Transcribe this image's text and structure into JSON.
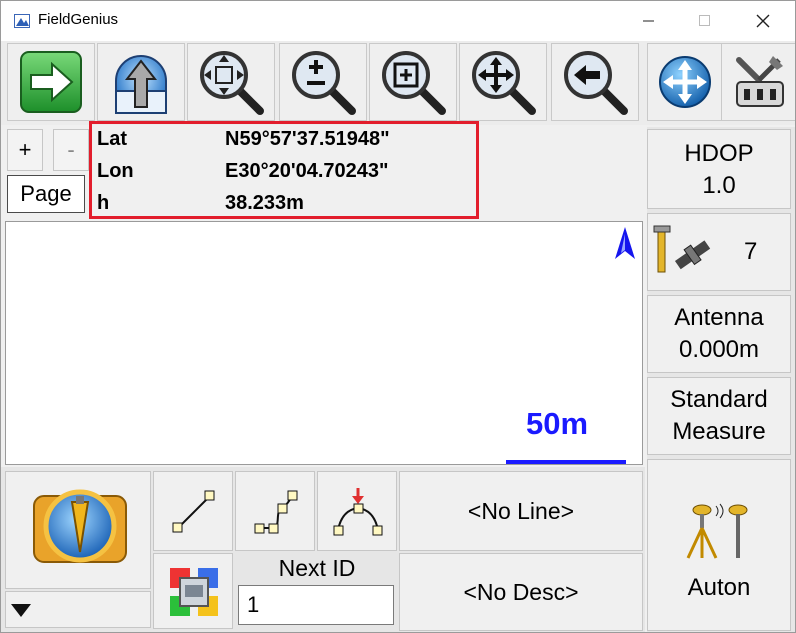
{
  "window": {
    "title": "FieldGenius"
  },
  "toolbar": {
    "icons": [
      "next-arrow-icon",
      "upload-icon",
      "zoom-extents-icon",
      "zoom-in-out-icon",
      "zoom-window-icon",
      "pan-icon",
      "zoom-previous-icon",
      "globe-icon",
      "tools-icon"
    ]
  },
  "zoom": {
    "plus": "+",
    "minus": "-"
  },
  "page_button": "Page",
  "coords": {
    "lat_label": "Lat",
    "lat_value": "N59°57'37.51948\"",
    "lon_label": "Lon",
    "lon_value": "E30°20'04.70243\"",
    "h_label": "h",
    "h_value": "38.233m"
  },
  "map": {
    "scale_label": "50m"
  },
  "status": {
    "hdop_label": "HDOP",
    "hdop_value": "1.0",
    "satellites": "7",
    "antenna_label": "Antenna",
    "antenna_value": "0.000m",
    "mode_line1": "Standard",
    "mode_line2": "Measure",
    "auton_label": "Auton"
  },
  "bottom": {
    "line_label": "<No Line>",
    "desc_label": "<No Desc>",
    "next_id_label": "Next ID",
    "next_id_value": "1"
  },
  "colors": {
    "highlight": "#e21d2c",
    "scale": "#1a1aff"
  }
}
